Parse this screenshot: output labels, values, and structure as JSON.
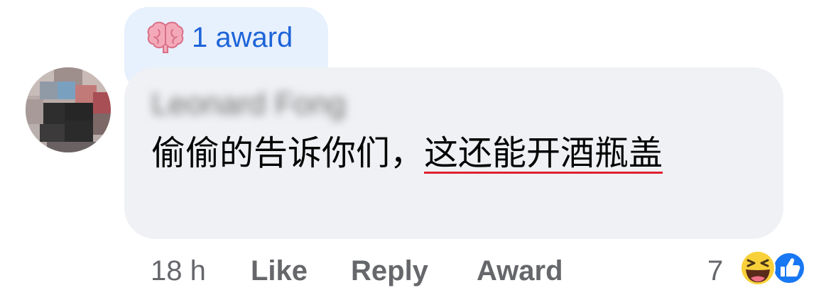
{
  "award": {
    "label": "1 award",
    "icon": "brain-icon"
  },
  "comment": {
    "author": "Leonard Fong",
    "text_plain": "偷偷的告诉你们，",
    "text_underlined": "这还能开酒瓶盖"
  },
  "meta": {
    "time": "18 h",
    "like_label": "Like",
    "reply_label": "Reply",
    "award_label": "Award"
  },
  "reactions": {
    "count": "7",
    "icons": [
      "haha-icon",
      "like-thumb-icon"
    ]
  },
  "colors": {
    "bubble": "#eff1f4",
    "award_tab": "#e7f0fd",
    "award_text": "#1d64d8",
    "meta_text": "#65676b",
    "underline": "#e0202f"
  }
}
